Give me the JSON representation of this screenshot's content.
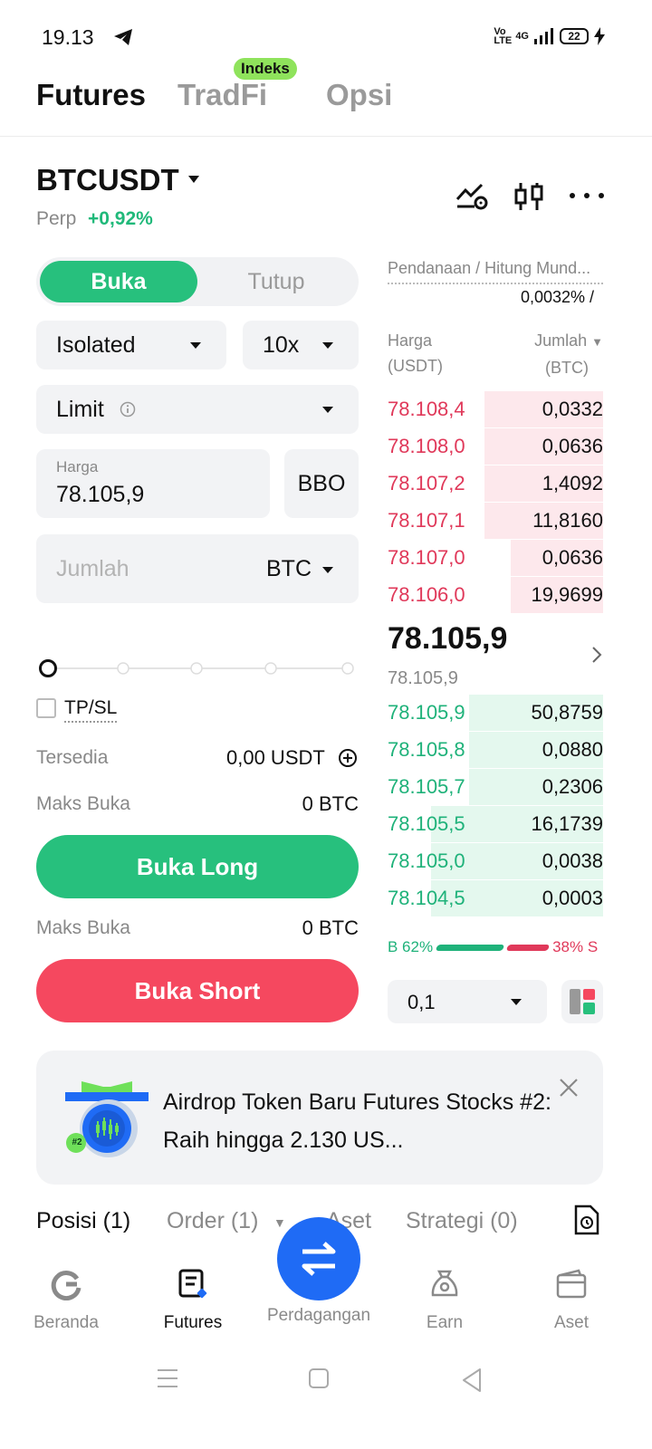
{
  "status_bar": {
    "time": "19.13",
    "network": "4G",
    "volte": "Vo LTE",
    "battery": "22"
  },
  "top_tabs": [
    {
      "label": "Futures",
      "active": true
    },
    {
      "label": "TradFi",
      "active": false,
      "badge": "Indeks"
    },
    {
      "label": "Opsi",
      "active": false
    }
  ],
  "pair": {
    "symbol": "BTCUSDT",
    "type": "Perp",
    "change": "+0,92%"
  },
  "order_form": {
    "side_tabs": [
      "Buka",
      "Tutup"
    ],
    "margin_mode": "Isolated",
    "leverage": "10x",
    "order_type": "Limit",
    "price_label": "Harga",
    "price_value": "78.105,9",
    "bbo": "BBO",
    "amount_placeholder": "Jumlah",
    "amount_unit": "BTC",
    "slider_percent": 0,
    "tpsl_label": "TP/SL",
    "available_label": "Tersedia",
    "available_value": "0,00 USDT",
    "max_open_label": "Maks Buka",
    "max_open_long": "0 BTC",
    "max_open_short": "0 BTC",
    "buy_button": "Buka Long",
    "sell_button": "Buka Short"
  },
  "order_book": {
    "funding_label": "Pendanaan / Hitung Mund...",
    "funding_rate": "0,0032% /",
    "price_header": "Harga",
    "price_unit": "(USDT)",
    "qty_header": "Jumlah",
    "qty_unit": "(BTC)",
    "asks": [
      {
        "price": "78.108,4",
        "qty": "0,0332",
        "depth": 0.55
      },
      {
        "price": "78.108,0",
        "qty": "0,0636",
        "depth": 0.55
      },
      {
        "price": "78.107,2",
        "qty": "1,4092",
        "depth": 0.55
      },
      {
        "price": "78.107,1",
        "qty": "11,8160",
        "depth": 0.55
      },
      {
        "price": "78.107,0",
        "qty": "0,0636",
        "depth": 0.43
      },
      {
        "price": "78.106,0",
        "qty": "19,9699",
        "depth": 0.43
      }
    ],
    "last_price": "78.105,9",
    "mark_price": "78.105,9",
    "bids": [
      {
        "price": "78.105,9",
        "qty": "50,8759",
        "depth": 0.62
      },
      {
        "price": "78.105,8",
        "qty": "0,0880",
        "depth": 0.62
      },
      {
        "price": "78.105,7",
        "qty": "0,2306",
        "depth": 0.62
      },
      {
        "price": "78.105,5",
        "qty": "16,1739",
        "depth": 0.8
      },
      {
        "price": "78.105,0",
        "qty": "0,0038",
        "depth": 0.8
      },
      {
        "price": "78.104,5",
        "qty": "0,0003",
        "depth": 0.8
      }
    ],
    "buy_ratio_label": "B 62%",
    "sell_ratio_label": "38% S",
    "buy_ratio": 0.62,
    "precision": "0,1"
  },
  "banner": {
    "badge": "#2",
    "text": "Airdrop Token Baru Futures Stocks #2: Raih hingga 2.130 US..."
  },
  "bottom_tabs": [
    "Posisi (1)",
    "Order (1)",
    "Aset",
    "Strategi (0)"
  ],
  "nav": [
    {
      "label": "Beranda",
      "icon": "home-icon"
    },
    {
      "label": "Futures",
      "icon": "futures-icon",
      "active": true
    },
    {
      "label": "Perdagangan",
      "icon": "trade-swap-icon"
    },
    {
      "label": "Earn",
      "icon": "earn-icon"
    },
    {
      "label": "Aset",
      "icon": "wallet-icon"
    }
  ],
  "colors": {
    "green": "#27c07d",
    "red": "#f5485f",
    "blue": "#1f6bf5"
  }
}
